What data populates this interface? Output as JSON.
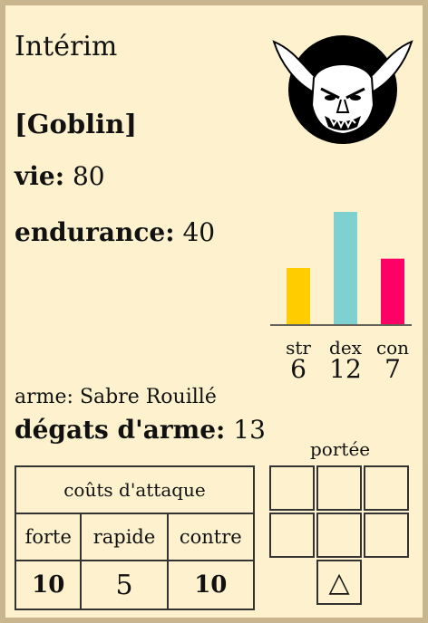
{
  "character": {
    "name": "Intérim",
    "race": "[Goblin]",
    "vie_label": "vie:",
    "vie_value": "80",
    "endurance_label": "endurance:",
    "endurance_value": "40"
  },
  "portrait": {
    "icon": "goblin-head-icon",
    "bg": "#000000"
  },
  "chart_data": {
    "type": "bar",
    "categories": [
      "str",
      "dex",
      "con"
    ],
    "values": [
      6,
      12,
      7
    ],
    "colors": [
      "#ffcc00",
      "#7fd0d0",
      "#ff0066"
    ],
    "ylim": [
      0,
      12
    ],
    "title": "",
    "xlabel": "",
    "ylabel": ""
  },
  "weapon": {
    "arme_label": "arme:",
    "arme_name": "Sabre Rouillé",
    "degats_label": "dégats d'arme:",
    "degats_value": "13"
  },
  "couts": {
    "title": "coûts d'attaque",
    "headers": [
      "forte",
      "rapide",
      "contre"
    ],
    "values": [
      "10",
      "5",
      "10"
    ]
  },
  "portee": {
    "label": "portée",
    "marker": "△"
  },
  "colors": {
    "card_bg": "#fdf2cd",
    "border": "#c9b68f"
  }
}
